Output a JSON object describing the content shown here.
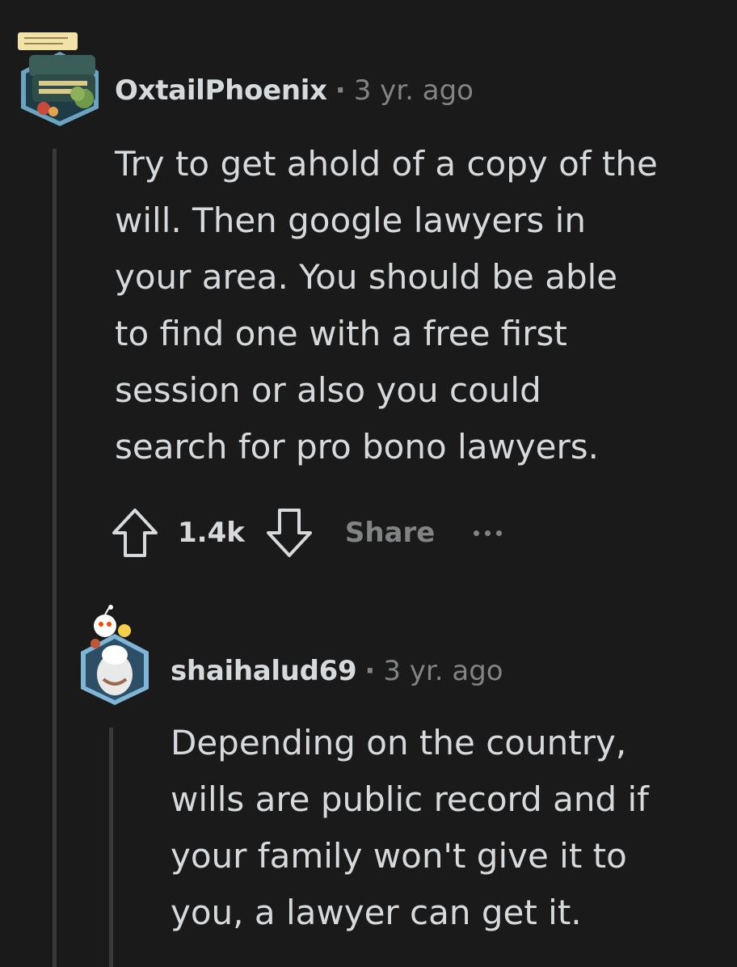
{
  "comments": [
    {
      "username": "OxtailPhoenix",
      "separator": "·",
      "time": "3 yr. ago",
      "avatar_icon": "typewriter-avatar-icon",
      "body": "Try to get ahold of a copy of the will. Then google lawyers in your area. You should be able to find one with a free first session or also you could search for pro bono lawyers.",
      "body_lines": [
        "Try to get ahold of a copy of the",
        "will. Then google lawyers in",
        "your area. You should be able",
        "to find one with a free first",
        "session or also you could",
        "search for pro bono lawyers."
      ],
      "actions": {
        "upvote_icon": "upvote-arrow-icon",
        "vote_count": "1.4k",
        "downvote_icon": "downvote-arrow-icon",
        "share_label": "Share",
        "more_icon": "more-dots-icon"
      }
    },
    {
      "username": "shaihalud69",
      "separator": "·",
      "time": "3 yr. ago",
      "avatar_icon": "snoo-avatar-icon",
      "body": "Depending on the country, wills are public record and if your family won't give it to you, a lawyer can get it.",
      "body_lines": [
        "Depending on the country,",
        "wills are public record and if",
        "your family won't give it to",
        "you, a lawyer can get it."
      ]
    }
  ],
  "colors": {
    "background": "#1a1a1b",
    "text": "#d7dadc",
    "muted": "#818384",
    "thread_line": "#3a3a3c"
  }
}
